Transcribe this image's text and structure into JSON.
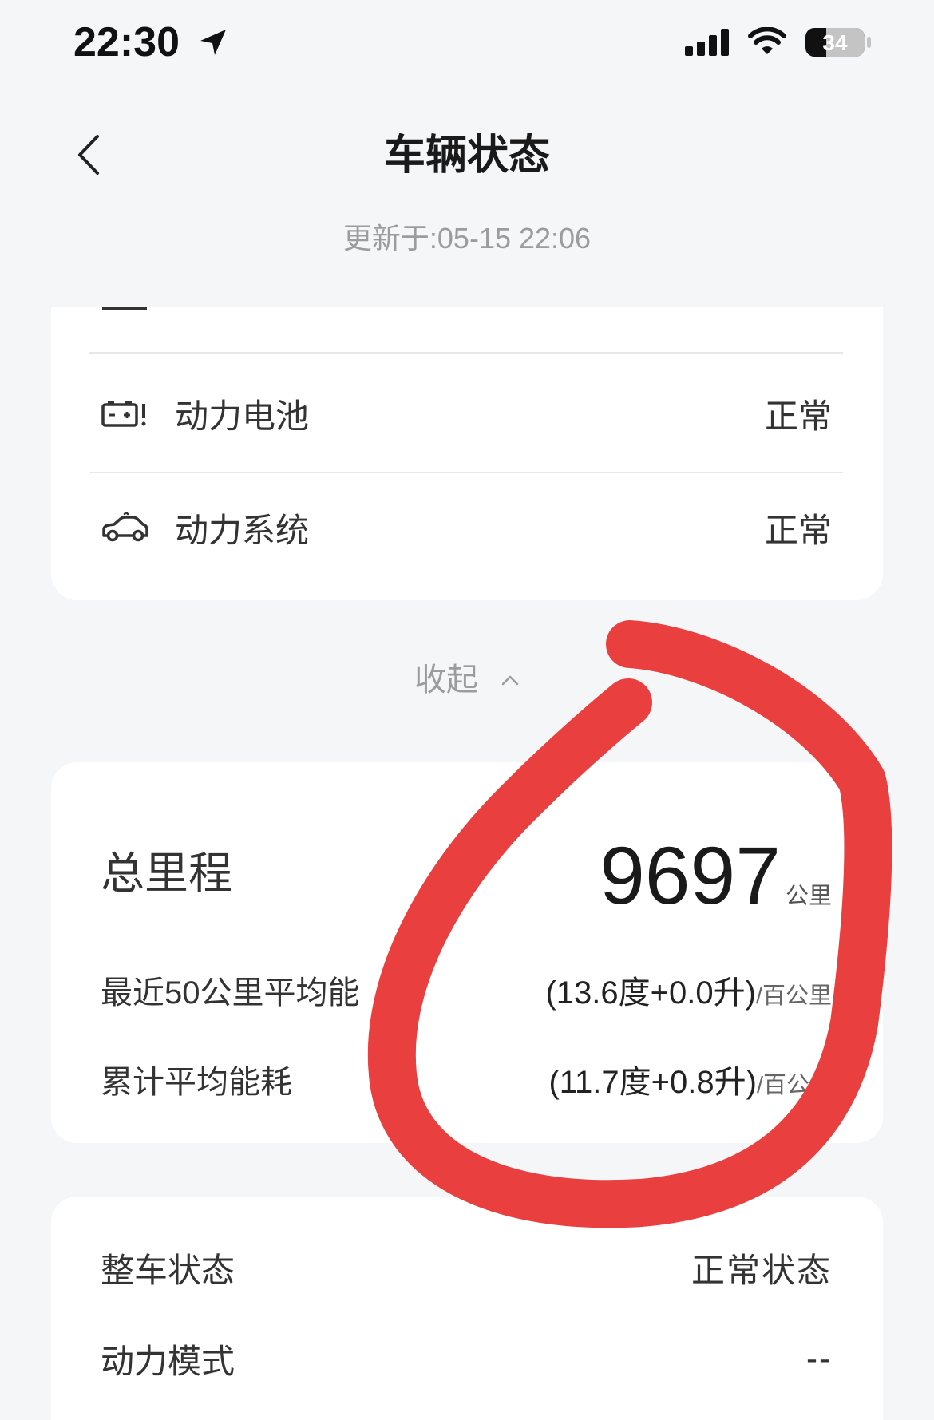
{
  "status_bar": {
    "time": "22:30",
    "battery_level": "34",
    "icons": [
      "location-arrow-icon",
      "cellular-signal-icon",
      "wifi-icon",
      "battery-icon"
    ]
  },
  "header": {
    "title": "车辆状态",
    "back_icon": "chevron-left-icon"
  },
  "updated_text": "更新于:05-15 22:06",
  "status_card": {
    "rows": [
      {
        "icon": "battery-warning-icon",
        "label": "动力电池",
        "value": "正常"
      },
      {
        "icon": "car-icon",
        "label": "动力系统",
        "value": "正常"
      }
    ]
  },
  "collapse": {
    "label": "收起",
    "icon": "chevron-up-icon"
  },
  "mileage_card": {
    "title": "总里程",
    "value": "9697",
    "unit": "公里",
    "rows": [
      {
        "label": "最近50公里平均能",
        "value": "(13.6度+0.0升)",
        "unit": "/百公里"
      },
      {
        "label": "累计平均能耗",
        "value": "(11.7度+0.8升)",
        "unit": "/百公"
      }
    ]
  },
  "vehicle_card": {
    "rows": [
      {
        "label": "整车状态",
        "value": "正常状态"
      },
      {
        "label": "动力模式",
        "value": "--"
      }
    ]
  },
  "annotation": {
    "shape": "hand-drawn-circle",
    "color": "#E9403F"
  },
  "colors": {
    "background": "#F5F6F8",
    "card": "#FFFFFF",
    "text_primary": "#333333",
    "text_secondary": "#9C9C9C",
    "annotation": "#E9403F"
  }
}
